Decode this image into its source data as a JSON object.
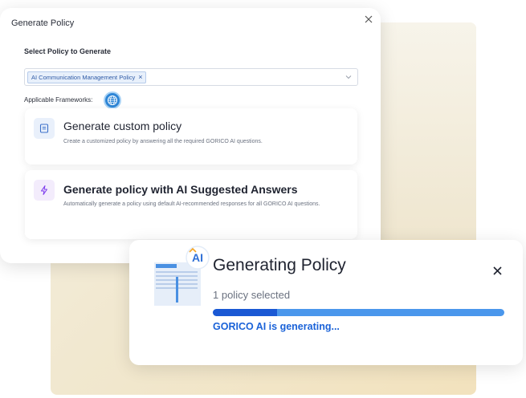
{
  "dialog": {
    "title": "Generate Policy",
    "select_label": "Select Policy to Generate",
    "selected_policy": "AI Communication Management Policy",
    "chip_remove": "×",
    "frameworks_label": "Applicable Frameworks:",
    "framework_badge_icon": "globe-badge-icon"
  },
  "options": [
    {
      "title": "Generate custom policy",
      "description": "Create a customized policy by answering all the required GORICO AI questions.",
      "icon": "document-icon"
    },
    {
      "title": "Generate policy with AI Suggested Answers",
      "description": "Automatically generate a policy using default AI-recommended responses for all GORICO AI questions.",
      "icon": "lightning-icon"
    }
  ],
  "progress": {
    "title": "Generating Policy",
    "subtitle": "1 policy selected",
    "status": "GORICO AI is generating...",
    "percent": 22,
    "ai_badge_text": "AI"
  },
  "colors": {
    "accent": "#1a58d4",
    "track": "#4a97ec",
    "status_text": "#1a62d8",
    "chip_bg": "#e8f0fb"
  }
}
